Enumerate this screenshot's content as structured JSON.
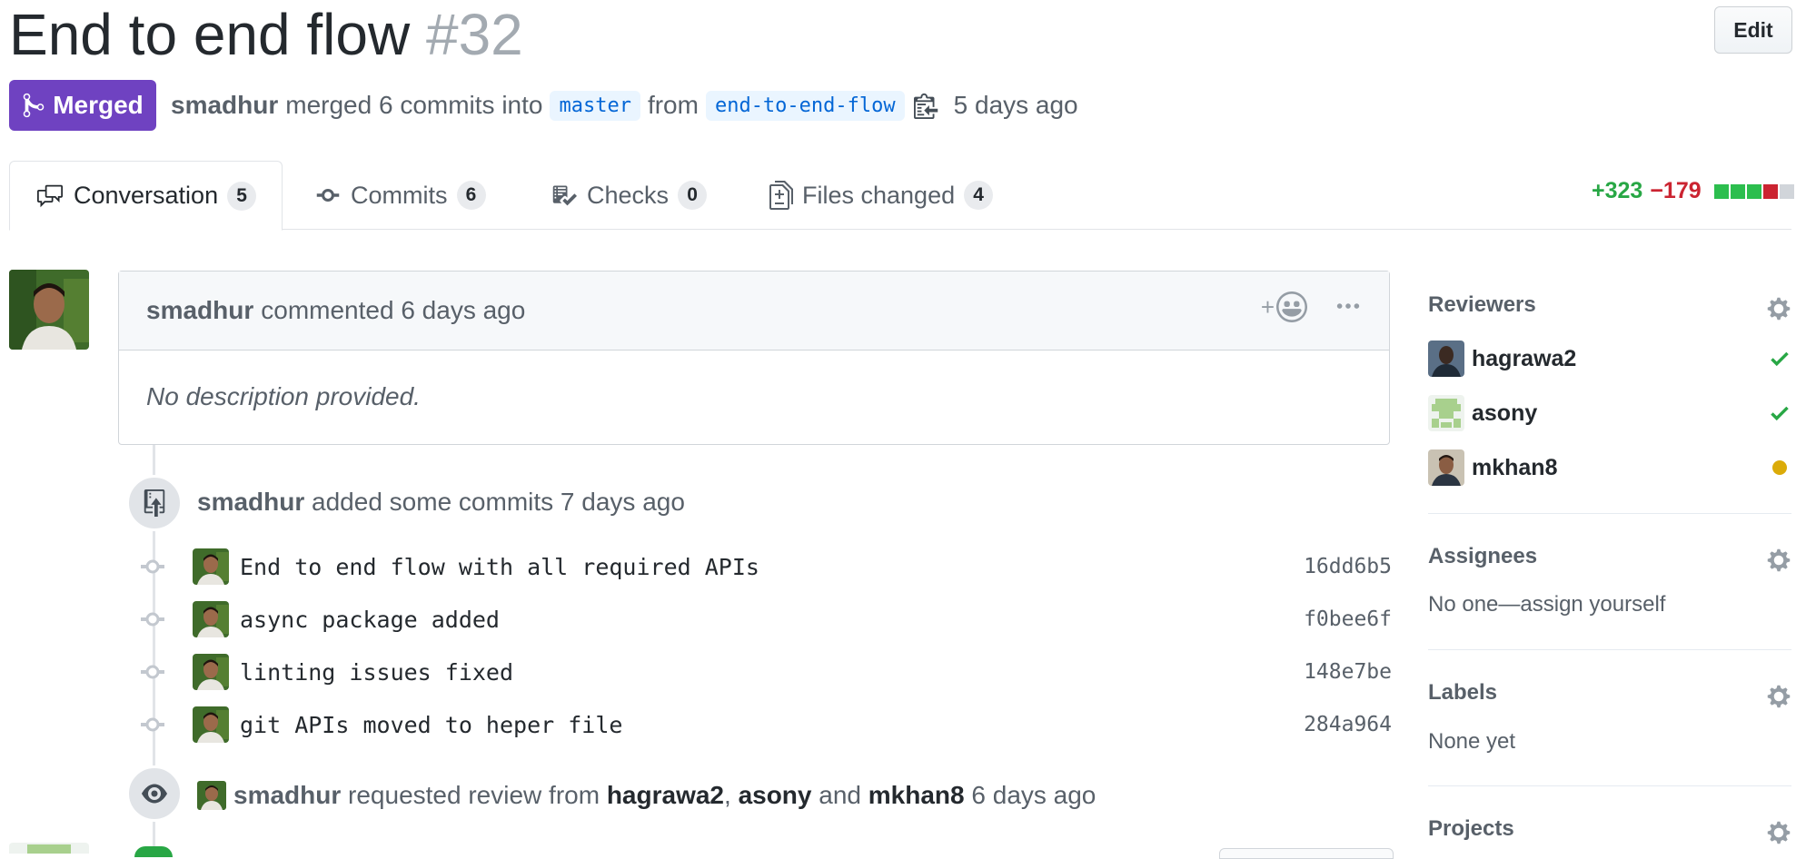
{
  "header": {
    "title": "End to end flow",
    "number": "#32",
    "edit_label": "Edit",
    "state_label": "Merged",
    "author": "smadhur",
    "merged_text": "merged 6 commits into",
    "base_branch": "master",
    "from_text": "from",
    "head_branch": "end-to-end-flow",
    "time": "5 days ago"
  },
  "tabs": [
    {
      "label": "Conversation",
      "count": "5",
      "icon": "comment-discussion-icon"
    },
    {
      "label": "Commits",
      "count": "6",
      "icon": "git-commit-icon"
    },
    {
      "label": "Checks",
      "count": "0",
      "icon": "checklist-icon"
    },
    {
      "label": "Files changed",
      "count": "4",
      "icon": "file-diff-icon"
    }
  ],
  "diffstat": {
    "additions": "+323",
    "deletions": "−179",
    "blocks": [
      "added",
      "added",
      "added",
      "deleted",
      "neutral"
    ],
    "colors": {
      "added": "#2cbe4e",
      "deleted": "#cb2431",
      "neutral": "#d1d5da"
    }
  },
  "comment": {
    "author": "smadhur",
    "action": "commented 6 days ago",
    "reaction_plus": "+",
    "body": "No description provided."
  },
  "commits_event": {
    "author": "smadhur",
    "text": "added some commits 7 days ago",
    "commits": [
      {
        "message": "End to end flow with all required APIs",
        "sha": "16dd6b5"
      },
      {
        "message": "async package added",
        "sha": "f0bee6f"
      },
      {
        "message": "linting issues fixed",
        "sha": "148e7be"
      },
      {
        "message": "git APIs moved to heper file",
        "sha": "284a964"
      }
    ]
  },
  "review_event": {
    "author": "smadhur",
    "text1": "requested review from",
    "reviewer1": "hagrawa2",
    "sep": ",",
    "reviewer2": "asony",
    "and_text": "and",
    "reviewer3": "mkhan8",
    "time": "6 days ago"
  },
  "sidebar": {
    "reviewers_title": "Reviewers",
    "reviewers": [
      {
        "name": "hagrawa2",
        "status": "approved"
      },
      {
        "name": "asony",
        "status": "approved"
      },
      {
        "name": "mkhan8",
        "status": "pending"
      }
    ],
    "assignees_title": "Assignees",
    "assignees_text": "No one—assign yourself",
    "labels_title": "Labels",
    "labels_text": "None yet",
    "projects_title": "Projects"
  },
  "colors": {
    "merged": "#6f42c1",
    "approved": "#28a745",
    "pending": "#dbab09",
    "link": "#0366d6"
  }
}
